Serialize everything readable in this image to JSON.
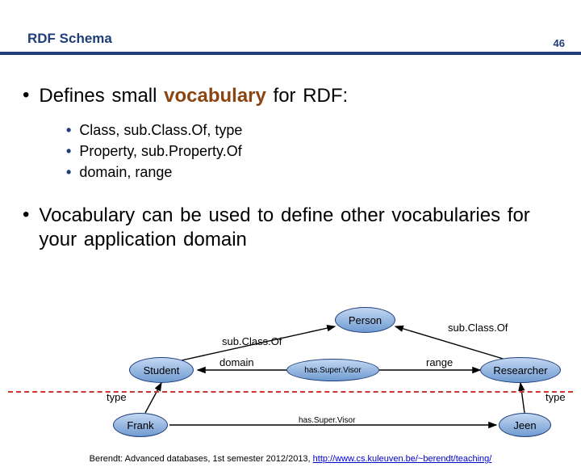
{
  "slide_number": "46",
  "title": "RDF Schema",
  "bullets": {
    "b1_pre": "Defines small ",
    "b1_bold": "vocabulary",
    "b1_post": " for RDF:",
    "sub1": "Class, sub.Class.Of, type",
    "sub2": "Property, sub.Property.Of",
    "sub3": "domain, range",
    "b2": "Vocabulary can be used to define other vocabularies for your application domain"
  },
  "diagram": {
    "nodes": {
      "person": "Person",
      "student": "Student",
      "hasSuperVisor": "has.Super.Visor",
      "researcher": "Researcher",
      "frank": "Frank",
      "jeen": "Jeen"
    },
    "edges": {
      "subClassOf": "sub.Class.Of",
      "domain": "domain",
      "range": "range",
      "type": "type",
      "hasSuperVisorProp": "has.Super.Visor"
    }
  },
  "footer": {
    "text_pre": "Berendt: Advanced databases, 1st semester 2012/2013, ",
    "link": "http://www.cs.kuleuven.be/~berendt/teaching/"
  }
}
